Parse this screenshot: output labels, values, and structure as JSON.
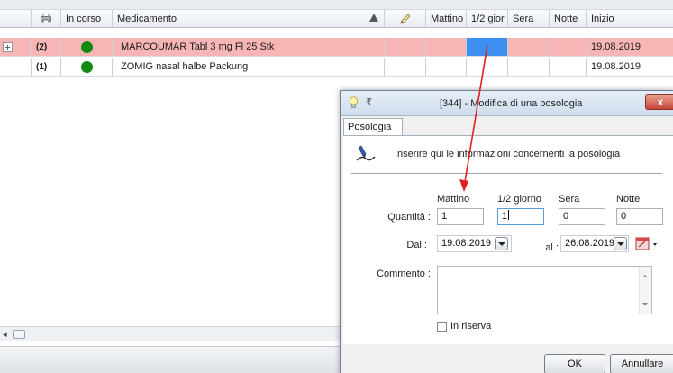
{
  "grid": {
    "header": {
      "col_in_corso": "In corso",
      "col_medicamento": "Medicamento",
      "col_mattino": "Mattino",
      "col_mezzo": "1/2 gior",
      "col_sera": "Sera",
      "col_notte": "Notte",
      "col_inizio": "Inizio"
    },
    "rows": [
      {
        "count": "(2)",
        "name": "MARCOUMAR Tabl 3 mg Fl 25 Stk",
        "start": "19.08.2019"
      },
      {
        "count": "(1)",
        "name": "ZOMIG nasal halbe Packung",
        "start": "19.08.2019"
      }
    ]
  },
  "dialog": {
    "title": "[344] - Modifica di una posologia",
    "pin": "₹",
    "close": "x",
    "tab": "Posologia",
    "info": "Inserire qui le informazioni concernenti la posologia",
    "col_mattino": "Mattino",
    "col_mezzo": "1/2 giorno",
    "col_sera": "Sera",
    "col_notte": "Notte",
    "quantita_label": "Quantità :",
    "q_mattino": "1",
    "q_mezzo": "1",
    "q_sera": "0",
    "q_notte": "0",
    "dal_label": "Dal :",
    "dal_value": "19.08.2019",
    "al_label": "al :",
    "al_value": "26.08.2019",
    "commento_label": "Commento :",
    "in_riserva": "In riserva",
    "ok_key": "O",
    "ok_rest": "K",
    "annullare_key": "A",
    "annullare_rest": "nnullare"
  },
  "colors": {
    "row_highlight": "#f7b5b6",
    "selected_cell": "#3d8ff0",
    "status_dot": "#118a11",
    "arrow": "#e02020"
  },
  "icons": [
    "expand-icon",
    "printer-icon",
    "pencil-icon",
    "sort-up-icon",
    "lightbulb-icon",
    "pin-icon",
    "close-icon",
    "signature-icon",
    "dropdown-icon",
    "calendar-icon",
    "scroll-left-icon"
  ]
}
